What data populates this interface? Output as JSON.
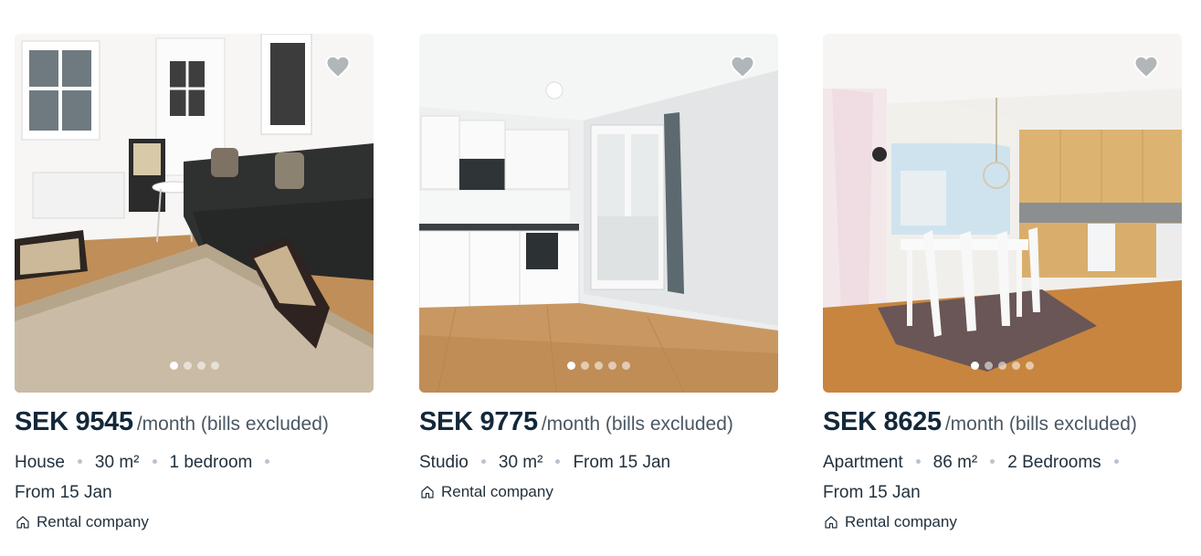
{
  "listings": [
    {
      "price": "SEK 9545",
      "period": "/month (bills excluded)",
      "type": "House",
      "size": "30 m²",
      "rooms": "1 bedroom",
      "available": "From 15 Jan",
      "landlord": "Rental company",
      "photo_count": 4,
      "active_photo": 1
    },
    {
      "price": "SEK 9775",
      "period": "/month (bills excluded)",
      "type": "Studio",
      "size": "30 m²",
      "available": "From 15 Jan",
      "landlord": "Rental company",
      "photo_count": 5,
      "active_photo": 1
    },
    {
      "price": "SEK 8625",
      "period": "/month (bills excluded)",
      "type": "Apartment",
      "size": "86 m²",
      "rooms": "2 Bedrooms",
      "available": "From 15 Jan",
      "landlord": "Rental company",
      "photo_count": 5,
      "active_photo": 1
    }
  ],
  "icons": {
    "favorite": "heart-icon",
    "landlord": "house-icon"
  },
  "colors": {
    "price": "#13283a",
    "text": "#22313d",
    "separator": "#b9c4cf"
  }
}
